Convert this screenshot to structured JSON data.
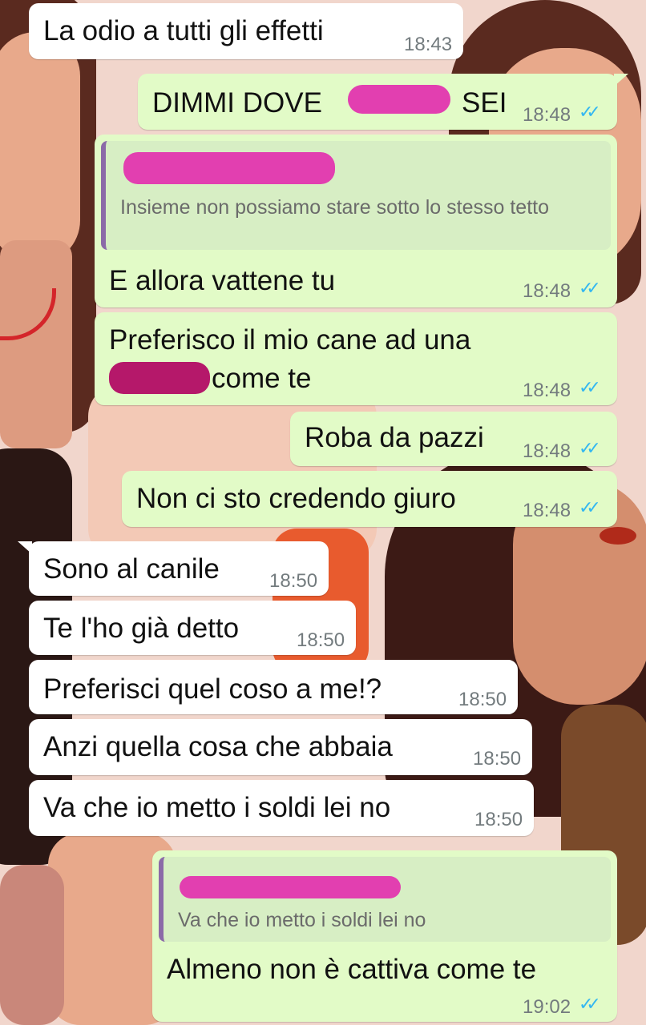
{
  "messages": [
    {
      "text": "La odio a tutti gli effetti",
      "time": "18:43",
      "dir": "in"
    },
    {
      "text_before": "DIMMI DOVE",
      "text_after": "SEI",
      "time": "18:48",
      "dir": "out"
    },
    {
      "quote_text": "Insieme non possiamo stare sotto lo stesso tetto",
      "text": "E allora vattene tu",
      "time": "18:48",
      "dir": "out"
    },
    {
      "line1": "Preferisco il mio cane ad una",
      "line2": "come te",
      "time": "18:48",
      "dir": "out"
    },
    {
      "text": "Roba da pazzi",
      "time": "18:48",
      "dir": "out"
    },
    {
      "text": "Non ci sto credendo giuro",
      "time": "18:48",
      "dir": "out"
    },
    {
      "text": "Sono al canile",
      "time": "18:50",
      "dir": "in"
    },
    {
      "text": "Te l'ho già detto",
      "time": "18:50",
      "dir": "in"
    },
    {
      "text": "Preferisci quel coso a me!?",
      "time": "18:50",
      "dir": "in"
    },
    {
      "text": "Anzi quella cosa che abbaia",
      "time": "18:50",
      "dir": "in"
    },
    {
      "text": "Va che io metto i soldi lei no",
      "time": "18:50",
      "dir": "in"
    },
    {
      "quote_text": "Va che io metto i soldi lei no",
      "text": "Almeno non è cattiva come te",
      "time": "19:02",
      "dir": "out"
    }
  ],
  "ticks_glyph": "✓✓",
  "colors": {
    "incoming_bubble": "#ffffff",
    "outgoing_bubble": "#e2fbc7",
    "read_ticks": "#34b7f1",
    "redaction": "#e23fb0"
  }
}
